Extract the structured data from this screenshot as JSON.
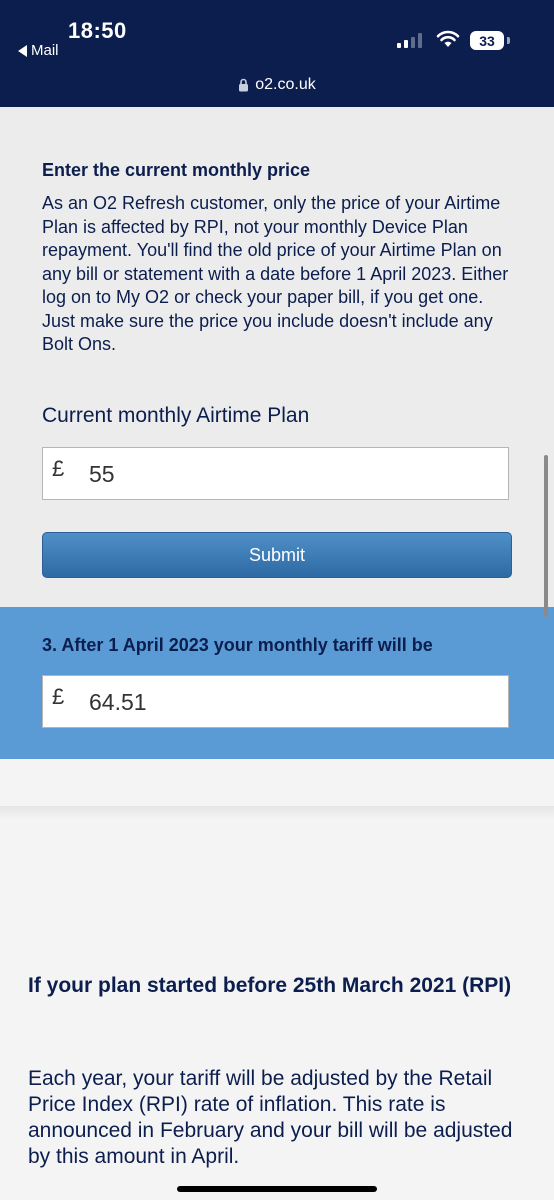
{
  "status_bar": {
    "time": "18:50",
    "back_label": "Mail",
    "battery": "33"
  },
  "browser": {
    "url": "o2.co.uk"
  },
  "form": {
    "heading": "Enter the current monthly price",
    "description": "As an O2 Refresh customer, only the price of your Airtime Plan is affected by RPI, not your monthly Device Plan repayment. You'll find the old price of your Airtime Plan on any bill or statement with a date before 1 April 2023. Either log on to My O2 or check your paper bill, if you get one. Just make sure the price you include doesn't include any Bolt Ons.",
    "field_label": "Current monthly Airtime Plan",
    "currency_symbol": "£",
    "amount_value": "55",
    "submit_label": "Submit"
  },
  "result": {
    "title": "3. After 1 April 2023 your monthly tariff will be",
    "currency_symbol": "£",
    "value": "64.51"
  },
  "info": {
    "heading": "If your plan started before 25th March 2021 (RPI)",
    "text": "Each year, your tariff will be adjusted by the Retail Price Index (RPI) rate of inflation. This rate is announced in February and your bill will be adjusted by this amount in April."
  },
  "colors": {
    "header_bg": "#0c1e4e",
    "form_bg": "#ececec",
    "result_bg": "#5b9bd5",
    "text_navy": "#0c1e4e",
    "button_blue": "#3a78b5"
  }
}
